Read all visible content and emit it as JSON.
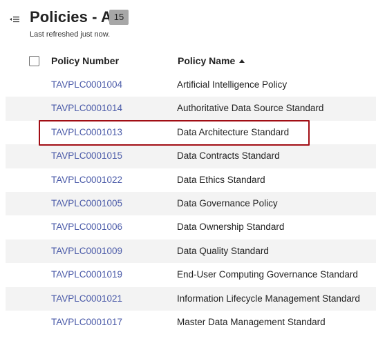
{
  "header": {
    "title": "Policies - All",
    "count": "15",
    "subtitle": "Last refreshed just now."
  },
  "table": {
    "columns": {
      "number": "Policy Number",
      "name": "Policy Name"
    },
    "sort": {
      "column": "name",
      "direction": "ascending"
    },
    "rows": [
      {
        "number": "TAVPLC0001004",
        "name": "Artificial Intelligence Policy"
      },
      {
        "number": "TAVPLC0001014",
        "name": "Authoritative Data Source Standard"
      },
      {
        "number": "TAVPLC0001013",
        "name": "Data Architecture Standard",
        "highlighted": true
      },
      {
        "number": "TAVPLC0001015",
        "name": "Data Contracts Standard"
      },
      {
        "number": "TAVPLC0001022",
        "name": "Data Ethics Standard"
      },
      {
        "number": "TAVPLC0001005",
        "name": "Data Governance Policy"
      },
      {
        "number": "TAVPLC0001006",
        "name": "Data Ownership Standard"
      },
      {
        "number": "TAVPLC0001009",
        "name": "Data Quality Standard"
      },
      {
        "number": "TAVPLC0001019",
        "name": "End-User Computing Governance Standard"
      },
      {
        "number": "TAVPLC0001021",
        "name": "Information Lifecycle Management Standard"
      },
      {
        "number": "TAVPLC0001017",
        "name": "Master Data Management Standard"
      }
    ]
  },
  "colors": {
    "link": "#4a5aa8",
    "highlight_border": "#a10d14",
    "badge_bg": "#a7a7a7",
    "stripe": "#f3f3f3"
  },
  "icons": {
    "collapse": "collapse-list-icon",
    "sort": "sort-ascending-icon"
  }
}
